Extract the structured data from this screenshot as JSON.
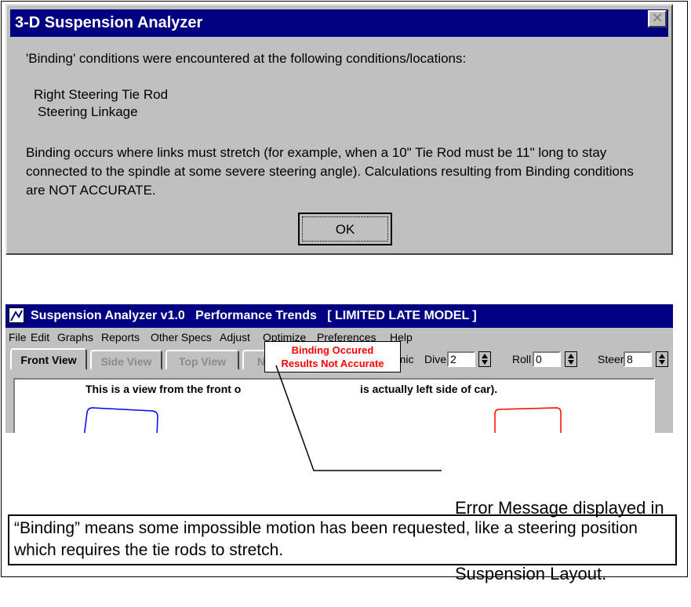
{
  "dialog": {
    "title": "3-D Suspension Analyzer",
    "close_label": "✕",
    "intro": "'Binding' conditions were encountered at the following conditions/locations:",
    "locations": [
      "Right Steering Tie Rod",
      "Steering Linkage"
    ],
    "body": "Binding occurs where links must stretch (for example, when a 10\" Tie Rod must be 11\" long to stay connected to the spindle at some severe steering angle).  Calculations resulting from Binding conditions are NOT ACCURATE.",
    "ok_label": "OK"
  },
  "app": {
    "title": "Suspension Analyzer v1.0   Performance Trends   [ LIMITED LATE MODEL ]",
    "menu": [
      "File",
      "Edit",
      "Graphs",
      "Reports",
      "Other Specs",
      "Adjust",
      "Optimize",
      "Preferences",
      "Help"
    ],
    "tabs": [
      "Front View",
      "Side View",
      "Top View",
      "No View"
    ],
    "dynamic_label": "Dynamic",
    "dynamic_checked": "X",
    "dive_label": "Dive",
    "dive_value": "2",
    "roll_label": "Roll",
    "roll_value": "0",
    "steer_label": "Steer",
    "steer_value": "8",
    "view_caption": "This is a view from the front o                                       is actually left side of car).",
    "colors": {
      "left_wheel": "#0000ff",
      "right_wheel": "#ff0000",
      "titlebar": "#000080"
    }
  },
  "error_box": {
    "line1": "Binding Occured",
    "line2": "Results Not Accurate"
  },
  "callout": {
    "line1": "Error Message displayed in",
    "line2": "Suspension Layout."
  },
  "note": "“Binding” means some impossible motion has been requested, like a steering position which requires the tie rods to stretch."
}
